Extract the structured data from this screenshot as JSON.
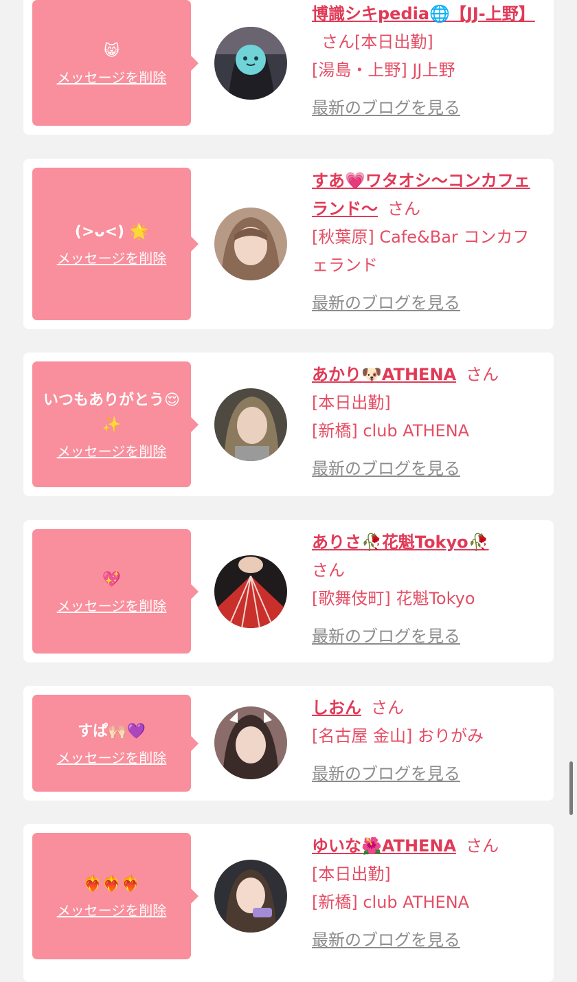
{
  "delete_label": "メッセージを削除",
  "blog_label": "最新のブログを見る",
  "cards": [
    {
      "message": "😸",
      "name": "博識シキpedia🌐【JJ-上野】",
      "san": "さん",
      "lines": [
        "[本日出勤]",
        "[湯島・上野] JJ上野"
      ],
      "avatar_color": "#3a3a44"
    },
    {
      "message": "(>ᴗ<) 🌟",
      "name": "すあ💗ワタオシ〜コンカフェランド〜",
      "san": "さん",
      "lines": [
        "[秋葉原] Cafe&Bar コンカフェランド"
      ],
      "avatar_color": "#b79a86"
    },
    {
      "message": "いつもありがとう😌✨",
      "name": "あかり🐶ATHENA",
      "san": "さん",
      "lines": [
        "[本日出勤]",
        "[新橋] club ATHENA"
      ],
      "avatar_color": "#4e4a42"
    },
    {
      "message": "💖",
      "name": "ありさ🥀花魁Tokyo🥀",
      "san": "さん",
      "lines": [
        "[歌舞伎町] 花魁Tokyo"
      ],
      "avatar_color": "#c9302c"
    },
    {
      "message": "すぱ🙌🏻💜",
      "name": "しおん",
      "san": "さん",
      "lines": [
        "[名古屋 金山] おりがみ"
      ],
      "avatar_color": "#8a6d6a"
    },
    {
      "message": "❤️‍🔥❤️‍🔥❤️‍🔥",
      "name": "ゆいな🌺ATHENA",
      "san": "さん",
      "lines": [
        "[本日出勤]",
        "[新橋] club ATHENA"
      ],
      "avatar_color": "#2f2f36"
    }
  ]
}
